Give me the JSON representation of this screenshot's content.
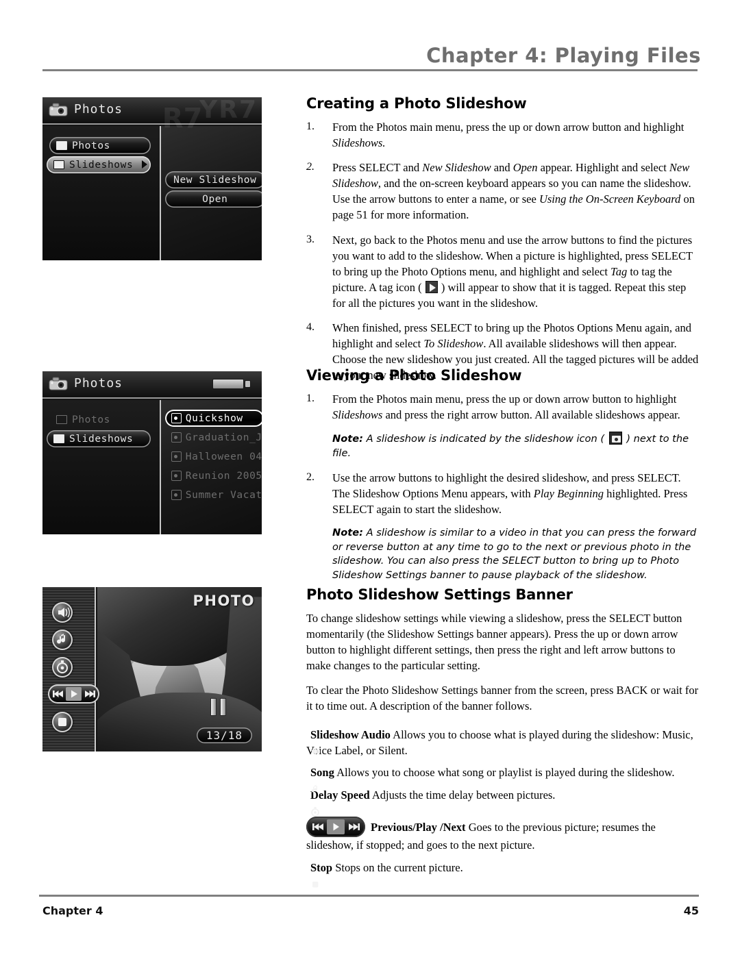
{
  "header": {
    "chapter_title": "Chapter 4: Playing Files"
  },
  "footer": {
    "chapter_label": "Chapter 4",
    "page_number": "45"
  },
  "sections": {
    "creating": {
      "heading": "Creating a Photo Slideshow",
      "steps": [
        {
          "num": "1.",
          "html": "From the Photos main menu, press the up or down arrow button and highlight <i>Slideshows.</i>"
        },
        {
          "num": "2.",
          "html": "Press SELECT and <i>New Slideshow</i> and <i>Open</i> appear. Highlight and select <i>New Slideshow</i>,  and the on-screen keyboard appears so you can name the slideshow. Use the arrow buttons to enter a name, or see <i>Using the On-Screen Keyboard</i> on page 51 for more information."
        },
        {
          "num": "3.",
          "html": "Next, go back to the Photos menu and use the arrow buttons to find the pictures you want to add to the slideshow. When a picture is highlighted, press SELECT to bring up the Photo Options menu, and highlight and select <i>Tag</i> to tag the picture. A tag icon ( <span class=\"inl-tag\"></span> ) will appear to show that it is tagged. Repeat this step for all the pictures you want in the slideshow."
        },
        {
          "num": "4.",
          "html": "When finished, press SELECT to bring up the Photos Options Menu again, and highlight and select <i>To Slideshow</i>. All available slideshows will then appear. Choose the new slideshow you just created. All the tagged pictures will be added to your new slideshow."
        }
      ]
    },
    "viewing": {
      "heading": "Viewing a Photo Slideshow",
      "step1": {
        "num": "1.",
        "html": "From the Photos main menu, press the up or down arrow button to highlight <i>Slideshows</i> and press the right arrow button. All available slideshows appear."
      },
      "note1": "<b>Note:</b> A slideshow is indicated by the slideshow icon ( <span class=\"inl-ss\"></span> ) next to the file.",
      "step2": {
        "num": "2.",
        "html": "Use the arrow buttons to highlight the desired slideshow, and press SELECT. The Slideshow Options Menu appears, with <i>Play Beginning</i> highlighted. Press SELECT again to start the slideshow."
      },
      "note2": "<b>Note:</b> A slideshow is similar to a video in that you can press the forward or reverse button at any time to go to the next or previous photo in the slideshow. You can also press the SELECT button to bring up to Photo Slideshow Settings banner to pause playback of the slideshow."
    },
    "banner": {
      "heading": "Photo Slideshow Settings Banner",
      "para1": "To change slideshow settings while viewing a slideshow, press the SELECT button momentarily (the Slideshow Settings banner appears). Press the up or down arrow button to highlight different settings, then press the right and left arrow buttons to make changes to the particular setting.",
      "para2": "To clear the Photo Slideshow Settings banner from the screen, press BACK or wait for it to time out. A description of the banner follows.",
      "glossary": [
        {
          "icon": "speaker-icon",
          "term": "Slideshow Audio",
          "desc": " Allows you to choose what is played during the slideshow: Music, Voice Label, or Silent."
        },
        {
          "icon": "music-note-icon",
          "term": "Song",
          "desc": " Allows you to choose what song or playlist is played during the slideshow."
        },
        {
          "icon": "timer-icon",
          "term": "Delay Speed",
          "desc": " Adjusts the time delay between pictures."
        },
        {
          "icon": "transport-icon",
          "term": "Previous/Play /Next",
          "desc": " Goes to the previous picture; resumes the slideshow, if stopped; and goes to the next picture."
        },
        {
          "icon": "stop-icon",
          "term": "Stop",
          "desc": " Stops on the current picture."
        }
      ]
    }
  },
  "screenshots": {
    "shot1": {
      "title": "Photos",
      "watermark": "YR7",
      "left_items": [
        {
          "label": "Photos",
          "state": "dark"
        },
        {
          "label": "Slideshows",
          "state": "selected"
        }
      ],
      "right_items": [
        {
          "label": "New Slideshow"
        },
        {
          "label": "Open"
        }
      ]
    },
    "shot2": {
      "title": "Photos",
      "left_items": [
        {
          "label": "Photos",
          "state": "ghost"
        },
        {
          "label": "Slideshows",
          "state": "dark"
        }
      ],
      "right_items": [
        {
          "label": "Quickshow",
          "state": "highlight"
        },
        {
          "label": "Graduation_Joe",
          "state": "ghost"
        },
        {
          "label": "Halloween 04",
          "state": "ghost"
        },
        {
          "label": "Reunion 2005",
          "state": "ghost"
        },
        {
          "label": "Summer Vacatio",
          "state": "ghost"
        }
      ]
    },
    "shot3": {
      "photo_label": "PHOTO",
      "counter": "13/18",
      "rail_icons": [
        "speaker-icon",
        "music-note-icon",
        "timer-icon",
        "transport-icon",
        "stop-icon"
      ]
    }
  }
}
